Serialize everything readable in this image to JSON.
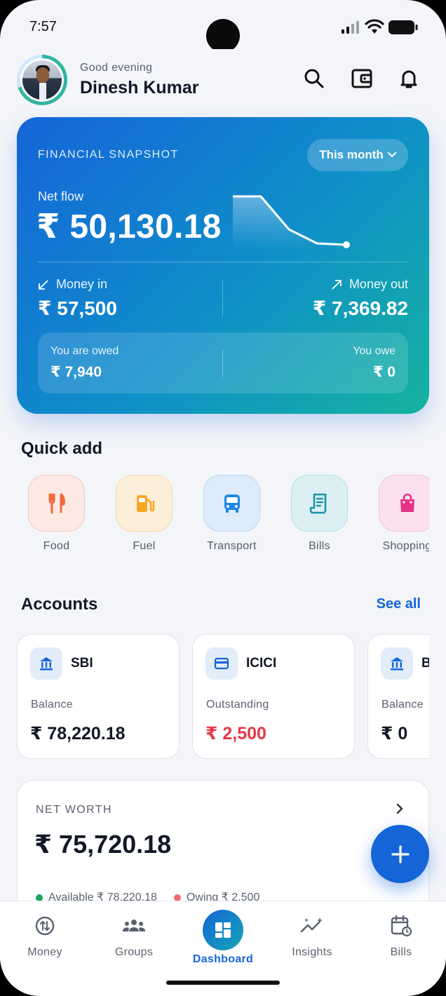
{
  "status_bar": {
    "time": "7:57"
  },
  "header": {
    "greeting": "Good evening",
    "user_name": "Dinesh Kumar"
  },
  "snapshot": {
    "label": "FINANCIAL SNAPSHOT",
    "period": "This month",
    "net_flow_label": "Net flow",
    "net_flow_value": "₹ 50,130.18",
    "money_in_label": "Money in",
    "money_in_value": "₹ 57,500",
    "money_out_label": "Money out",
    "money_out_value": "₹ 7,369.82",
    "owed_label": "You are owed",
    "owed_value": "₹ 7,940",
    "owe_label": "You owe",
    "owe_value": "₹ 0"
  },
  "quick_add": {
    "title": "Quick add",
    "items": [
      {
        "label": "Food",
        "icon": "utensils-icon"
      },
      {
        "label": "Fuel",
        "icon": "fuel-icon"
      },
      {
        "label": "Transport",
        "icon": "bus-icon"
      },
      {
        "label": "Bills",
        "icon": "receipt-icon"
      },
      {
        "label": "Shopping",
        "icon": "shopping-bag-icon"
      }
    ]
  },
  "accounts": {
    "title": "Accounts",
    "see_all": "See all",
    "items": [
      {
        "name": "SBI",
        "label": "Balance",
        "amount": "₹ 78,220.18"
      },
      {
        "name": "ICICI",
        "label": "Outstanding",
        "amount": "₹ 2,500"
      },
      {
        "name": "B",
        "label": "Balance",
        "amount": "₹ 0"
      }
    ]
  },
  "net_worth": {
    "label": "NET WORTH",
    "value": "₹ 75,720.18",
    "available": "Available ₹ 78,220.18",
    "owing": "Owing ₹ 2,500"
  },
  "nav": {
    "tabs": [
      {
        "label": "Money"
      },
      {
        "label": "Groups"
      },
      {
        "label": "Dashboard"
      },
      {
        "label": "Insights"
      },
      {
        "label": "Bills"
      }
    ]
  },
  "colors": {
    "accent": "#1565d8",
    "teal": "#14b39f",
    "negative": "#e53946",
    "available_dot": "#1aa35a",
    "owing_dot": "#ef6b6b"
  }
}
